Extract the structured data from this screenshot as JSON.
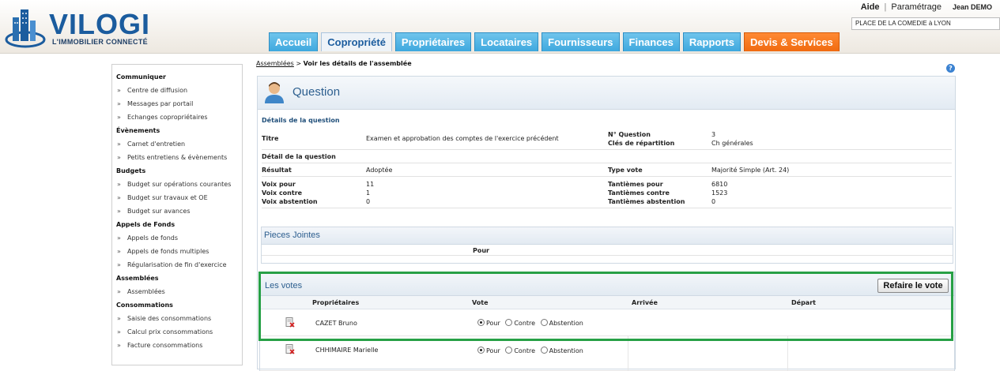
{
  "header": {
    "logo_text": "VILOGI",
    "logo_tagline": "L'IMMOBILIER CONNECTÉ",
    "help_link": "Aide",
    "settings_link": "Paramétrage",
    "separator": "|",
    "user_name": "Jean DEMO",
    "building_selector": "PLACE DE LA COMEDIE à LYON"
  },
  "tabs": [
    {
      "label": "Accueil"
    },
    {
      "label": "Copropriété"
    },
    {
      "label": "Propriétaires"
    },
    {
      "label": "Locataires"
    },
    {
      "label": "Fournisseurs"
    },
    {
      "label": "Finances"
    },
    {
      "label": "Rapports"
    },
    {
      "label": "Devis & Services"
    }
  ],
  "sidebar": {
    "arrow": "»",
    "sections": [
      {
        "title": "Communiquer",
        "items": [
          "Centre de diffusion",
          "Messages par portail",
          "Echanges copropriétaires"
        ]
      },
      {
        "title": "Évènements",
        "items": [
          "Carnet d'entretien",
          "Petits entretiens & évènements"
        ]
      },
      {
        "title": "Budgets",
        "items": [
          "Budget sur opérations courantes",
          "Budget sur travaux et OE",
          "Budget sur avances"
        ]
      },
      {
        "title": "Appels de Fonds",
        "items": [
          "Appels de fonds",
          "Appels de fonds multiples",
          "Régularisation de fin d'exercice"
        ]
      },
      {
        "title": "Assemblées",
        "items": [
          "Assemblées"
        ]
      },
      {
        "title": "Consommations",
        "items": [
          "Saisie des consommations",
          "Calcul prix consommations",
          "Facture consommations"
        ]
      }
    ]
  },
  "breadcrumb": {
    "link": "Assemblées",
    "separator": ">",
    "current": "Voir les détails de l'assemblée"
  },
  "help_icon": "?",
  "question": {
    "title": "Question",
    "details_title": "Détails de la question",
    "titre_label": "Titre",
    "titre_value": "Examen et approbation des comptes de l'exercice précédent",
    "num_label": "N° Question",
    "num_value": "3",
    "cles_label": "Clés de répartition",
    "cles_value": "Ch générales",
    "detail_label": "Détail de la question",
    "resultat_label": "Résultat",
    "resultat_value": "Adoptée",
    "type_vote_label": "Type vote",
    "type_vote_value": "Majorité Simple (Art. 24)",
    "voix_pour_label": "Voix pour",
    "voix_pour_value": "11",
    "voix_contre_label": "Voix contre",
    "voix_contre_value": "1",
    "voix_abst_label": "Voix abstention",
    "voix_abst_value": "0",
    "tant_pour_label": "Tantièmes pour",
    "tant_pour_value": "6810",
    "tant_contre_label": "Tantièmes contre",
    "tant_contre_value": "1523",
    "tant_abst_label": "Tantièmes abstention",
    "tant_abst_value": "0"
  },
  "pieces_jointes": {
    "title": "Pieces Jointes",
    "col_pour": "Pour"
  },
  "votes": {
    "title": "Les votes",
    "redo_button": "Refaire le vote",
    "columns": [
      "Propriétaires",
      "Vote",
      "Arrivée",
      "Départ"
    ],
    "options": [
      "Pour",
      "Contre",
      "Abstention"
    ],
    "rows": [
      {
        "name": "CAZET Bruno",
        "selected": "Pour"
      },
      {
        "name": "CHHIMAIRE Marielle",
        "selected": "Pour"
      }
    ]
  },
  "colors": {
    "tab_blue": "#3ea8de",
    "tab_orange": "#f06a10",
    "highlight_green": "#27a046",
    "title_blue": "#2d5f8f"
  }
}
